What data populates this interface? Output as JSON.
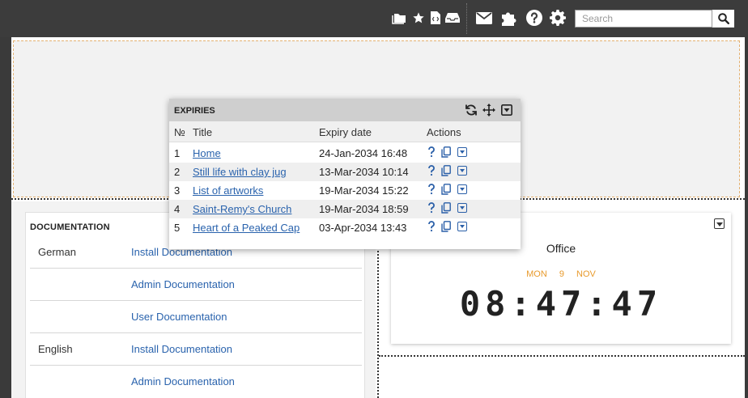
{
  "topbar": {
    "icons": [
      "folders-icon",
      "star-icon",
      "code-file-icon",
      "inbox-icon",
      "mail-icon",
      "puzzle-icon",
      "help-icon",
      "gear-icon"
    ],
    "search_placeholder": "Search"
  },
  "documentation": {
    "title": "DOCUMENTATION",
    "rows": [
      {
        "lang": "German",
        "link": "Install Documentation"
      },
      {
        "lang": "",
        "link": "Admin Documentation"
      },
      {
        "lang": "",
        "link": "User Documentation"
      },
      {
        "lang": "English",
        "link": "Install Documentation"
      },
      {
        "lang": "",
        "link": "Admin Documentation"
      }
    ]
  },
  "clock": {
    "title": "Office",
    "day": "MON",
    "date": "9",
    "month": "NOV",
    "time": "08:47:47",
    "date_color": "#e89a2c"
  },
  "expiries": {
    "title": "EXPIRIES",
    "columns": {
      "num": "№",
      "title": "Title",
      "expiry": "Expiry date",
      "actions": "Actions"
    },
    "rows": [
      {
        "num": "1",
        "title": "Home",
        "expiry": "24-Jan-2034 16:48"
      },
      {
        "num": "2",
        "title": "Still life with clay jug",
        "expiry": "13-Mar-2034 10:14"
      },
      {
        "num": "3",
        "title": "List of artworks",
        "expiry": "19-Mar-2034 15:22"
      },
      {
        "num": "4",
        "title": "Saint-Remy's Church",
        "expiry": "19-Mar-2034 18:59"
      },
      {
        "num": "5",
        "title": "Heart of a Peaked Cap",
        "expiry": "03-Apr-2034 13:43"
      }
    ]
  },
  "colors": {
    "link": "#2a63ad",
    "accent": "#e89a2c",
    "topbar": "#3c3c3c"
  }
}
